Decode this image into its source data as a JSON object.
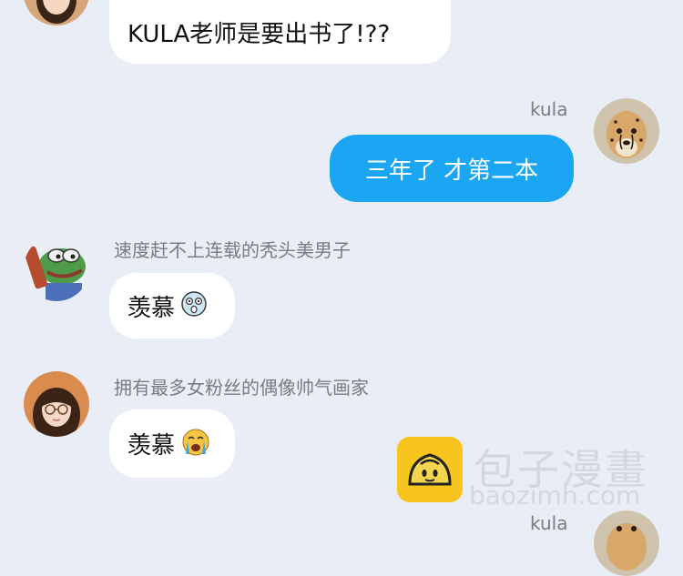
{
  "messages": [
    {
      "sender": "",
      "text": "KULA老师是要出书了!??",
      "side": "left"
    },
    {
      "sender": "kula",
      "text": "三年了 才第二本",
      "side": "right"
    },
    {
      "sender": "速度赶不上连载的秃头美男子",
      "text": "羡慕",
      "emoji": "surprised-emoji",
      "side": "left"
    },
    {
      "sender": "拥有最多女粉丝的偶像帅气画家",
      "text": "羡慕",
      "emoji": "crying-emoji",
      "side": "left"
    },
    {
      "sender": "kula",
      "text": "",
      "side": "right"
    }
  ],
  "avatars": [
    "girl-avatar",
    "cheetah-avatar",
    "frog-avatar",
    "girl-avatar",
    "cheetah-avatar"
  ],
  "watermark": {
    "brand": "包子漫畫",
    "url": "baozimh.com"
  },
  "colors": {
    "background": "#e9edf6",
    "bubble_left": "#ffffff",
    "bubble_right": "#1ba6f4",
    "watermark_logo": "#f7c51e"
  }
}
